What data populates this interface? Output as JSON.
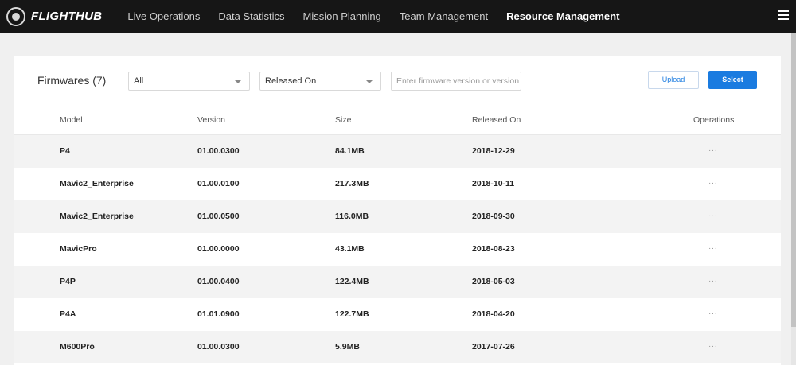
{
  "header": {
    "logo_text": "FLIGHTHUB",
    "nav": [
      {
        "label": "Live Operations"
      },
      {
        "label": "Data Statistics"
      },
      {
        "label": "Mission Planning"
      },
      {
        "label": "Team Management"
      },
      {
        "label": "Resource Management"
      }
    ],
    "active_nav": "Resource Management"
  },
  "panel": {
    "title": "Firmwares (7)",
    "filter_model": "All",
    "filter_sort": "Released On",
    "search_placeholder": "Enter firmware version or version",
    "upload_label": "Upload",
    "select_label": "Select"
  },
  "table": {
    "columns": {
      "model": "Model",
      "version": "Version",
      "size": "Size",
      "released": "Released On",
      "operations": "Operations"
    },
    "rows": [
      {
        "model": "P4",
        "version": "01.00.0300",
        "size": "84.1MB",
        "released": "2018-12-29",
        "ops": "···"
      },
      {
        "model": "Mavic2_Enterprise",
        "version": "01.00.0100",
        "size": "217.3MB",
        "released": "2018-10-11",
        "ops": "···"
      },
      {
        "model": "Mavic2_Enterprise",
        "version": "01.00.0500",
        "size": "116.0MB",
        "released": "2018-09-30",
        "ops": "···"
      },
      {
        "model": "MavicPro",
        "version": "01.00.0000",
        "size": "43.1MB",
        "released": "2018-08-23",
        "ops": "···"
      },
      {
        "model": "P4P",
        "version": "01.00.0400",
        "size": "122.4MB",
        "released": "2018-05-03",
        "ops": "···"
      },
      {
        "model": "P4A",
        "version": "01.01.0900",
        "size": "122.7MB",
        "released": "2018-04-20",
        "ops": "···"
      },
      {
        "model": "M600Pro",
        "version": "01.00.0300",
        "size": "5.9MB",
        "released": "2017-07-26",
        "ops": "···"
      }
    ]
  },
  "colors": {
    "topbar": "#161616",
    "accent": "#1a7be0"
  }
}
